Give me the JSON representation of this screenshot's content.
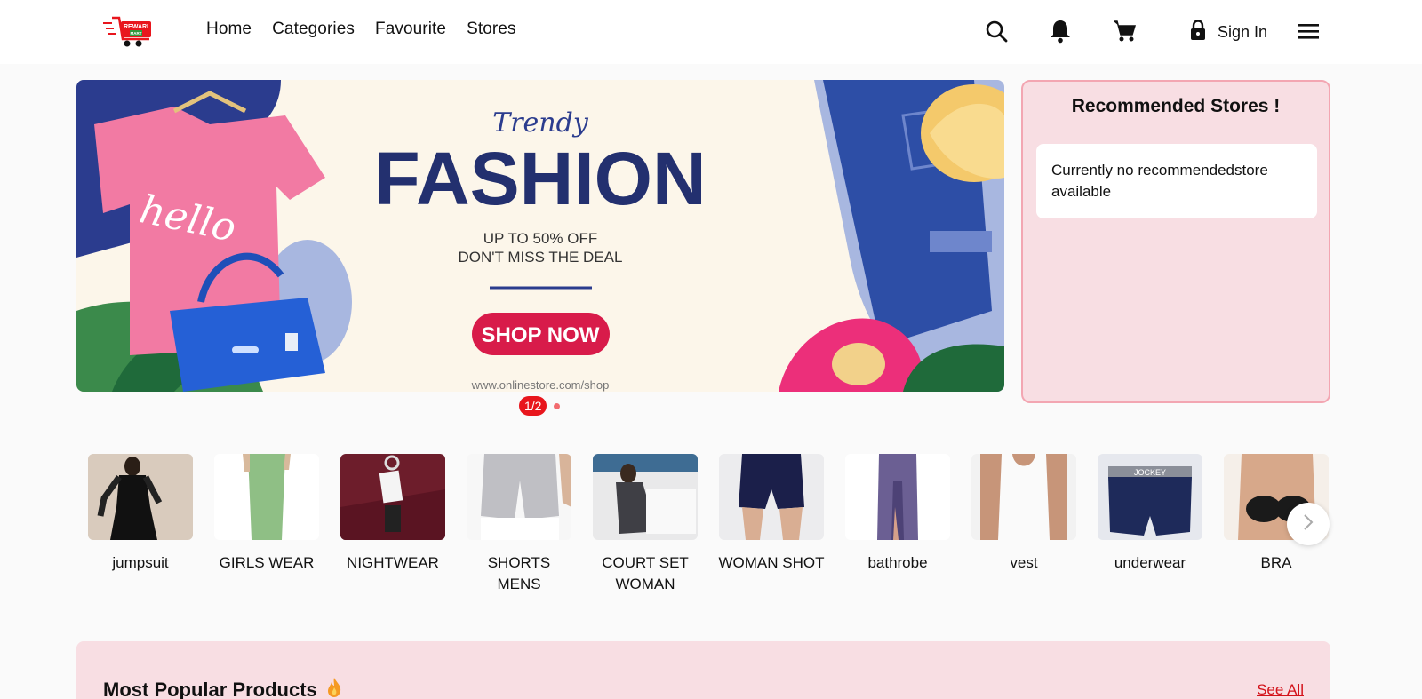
{
  "header": {
    "logo_text_top": "REWARI",
    "logo_text_bottom": "MART",
    "nav": [
      "Home",
      "Categories",
      "Favourite",
      "Stores"
    ],
    "icons": [
      "search-icon",
      "bell-icon",
      "cart-icon",
      "lock-icon",
      "menu-icon"
    ],
    "signin_label": "Sign In"
  },
  "banner": {
    "script_title": "Trendy",
    "title": "FASHION",
    "line1": "UP TO 50% OFF",
    "line2": "DON'T MISS THE DEAL",
    "cta": "SHOP NOW",
    "shirt_text": "hello",
    "url_text": "www.onlinestore.com/shop",
    "pager": "1/2"
  },
  "recommended": {
    "title": "Recommended Stores !",
    "empty_text": "Currently no recommendedstore available"
  },
  "categories": [
    {
      "label": "jumpsuit"
    },
    {
      "label": "GIRLS WEAR"
    },
    {
      "label": "NIGHTWEAR"
    },
    {
      "label": "SHORTS MENS"
    },
    {
      "label": "COURT SET WOMAN"
    },
    {
      "label": "WOMAN SHOT"
    },
    {
      "label": "bathrobe"
    },
    {
      "label": "vest"
    },
    {
      "label": "underwear"
    },
    {
      "label": "BRA"
    }
  ],
  "popular": {
    "title": "Most Popular Products",
    "see_all": "See All"
  },
  "colors": {
    "accent": "#e8161d",
    "rec_bg": "#f8dee3",
    "rec_border": "#f3a6b2",
    "navy": "#1e2a6b"
  }
}
